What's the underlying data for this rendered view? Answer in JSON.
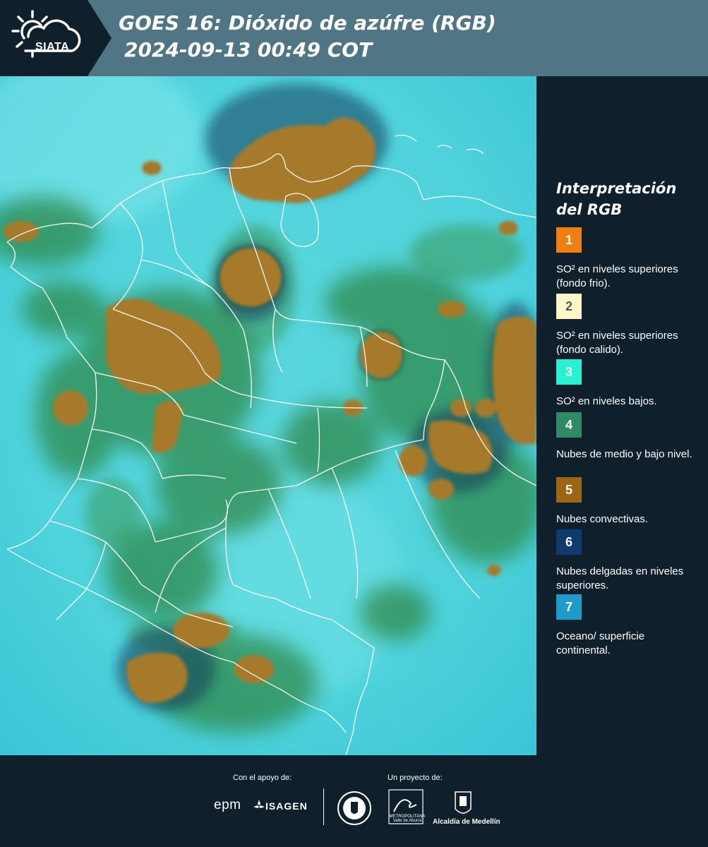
{
  "header": {
    "logo_text": "SIATA",
    "title_line1": "GOES 16: Dióxido de azúfre (RGB)",
    "title_line2": "2024-09-13 00:49 COT"
  },
  "legend": {
    "title_line1": "Interpretación",
    "title_line2": "del RGB",
    "items": [
      {
        "number": "1",
        "color": "#f07f12",
        "number_color": "#ffffff",
        "text": "SO² en niveles superiores (fondo frio)."
      },
      {
        "number": "2",
        "color": "#fdf6c6",
        "number_color": "#5a5a5a",
        "text": "SO² en niveles superiores (fondo calido)."
      },
      {
        "number": "3",
        "color": "#27f1d1",
        "number_color": "#ffffff",
        "text": "SO² en niveles bajos."
      },
      {
        "number": "4",
        "color": "#2e8b66",
        "number_color": "#ffffff",
        "text": "Nubes de medio y bajo nivel."
      },
      {
        "number": "5",
        "color": "#9c6613",
        "number_color": "#ffffff",
        "text": "Nubes convectivas."
      },
      {
        "number": "6",
        "color": "#0e3a6e",
        "number_color": "#ffffff",
        "text": "Nubes delgadas en niveles superiores."
      },
      {
        "number": "7",
        "color": "#1f9bc9",
        "number_color": "#ffffff",
        "text": "Oceano/ superficie continental."
      }
    ]
  },
  "footer": {
    "support_label": "Con el apoyo de:",
    "project_label": "Un proyecto de:",
    "epm_text": "epm",
    "isagen_text": "ISAGEN",
    "metro_text": "METROPOLITANA Valle de Aburrá",
    "alcaldia_text": "Alcaldía de Medellín"
  },
  "colors": {
    "background": "#0f1f2c",
    "header_bar": "#507685",
    "sea_cyan": "#45d4dc",
    "convective_brown": "#a87a2e",
    "mid_cloud_green": "#2e8a4c"
  }
}
